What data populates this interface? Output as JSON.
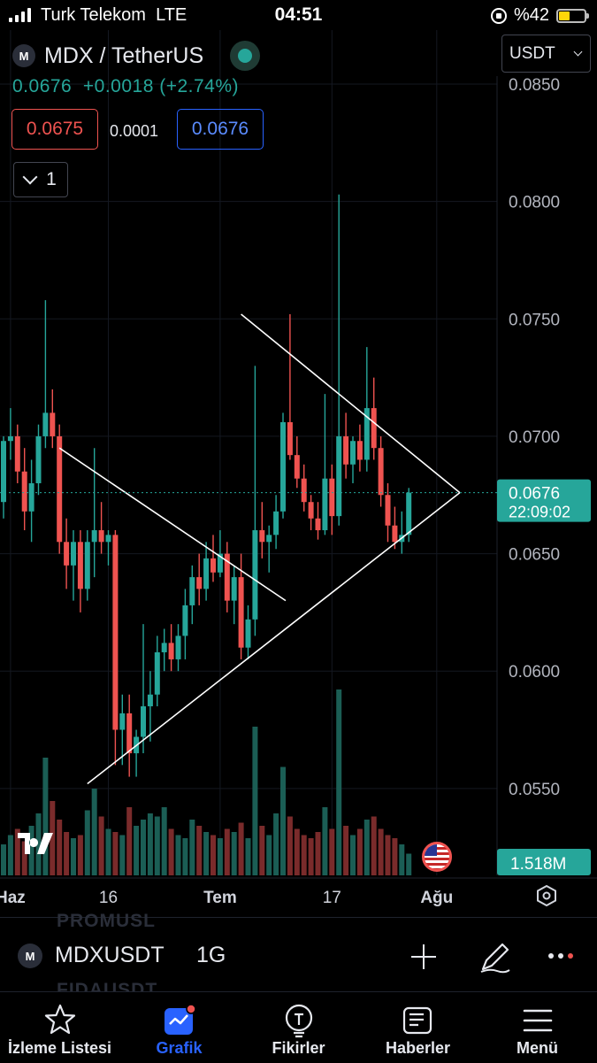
{
  "status_bar": {
    "carrier": "Turk Telekom",
    "network": "LTE",
    "time": "04:51",
    "battery": "%42"
  },
  "header": {
    "title": "MDX / TetherUS",
    "price": "0.0676",
    "change": "+0.0018 (+2.74%)",
    "bid": "0.0675",
    "spread": "0.0001",
    "ask": "0.0676",
    "indicator_count": "1",
    "currency": "USDT",
    "logo_glyph": "M"
  },
  "colors": {
    "up": "#26a69a",
    "down": "#ef5350",
    "accent": "#2962ff",
    "background": "#000000"
  },
  "chart_data": {
    "type": "candlestick",
    "interval": "1G",
    "y_ticks": [
      "0.0850",
      "0.0800",
      "0.0750",
      "0.0700",
      "0.0650",
      "0.0600",
      "0.0550"
    ],
    "y_range": [
      0.0513,
      0.0873
    ],
    "x_ticks": [
      {
        "label": "Haz",
        "index": 1
      },
      {
        "label": "16",
        "index": 15
      },
      {
        "label": "Tem",
        "index": 31
      },
      {
        "label": "17",
        "index": 47
      },
      {
        "label": "Ağu",
        "index": 62
      }
    ],
    "last_price": {
      "value": 0.0676,
      "label": "0.0676",
      "countdown": "22:09:02"
    },
    "volume_label": "1.518M",
    "candles": [
      [
        0.0672,
        0.07,
        0.0665,
        0.0698
      ],
      [
        0.0698,
        0.0712,
        0.069,
        0.07
      ],
      [
        0.07,
        0.0705,
        0.068,
        0.0685
      ],
      [
        0.0685,
        0.0695,
        0.066,
        0.0668
      ],
      [
        0.0668,
        0.069,
        0.0655,
        0.068
      ],
      [
        0.068,
        0.0705,
        0.0675,
        0.07
      ],
      [
        0.07,
        0.0758,
        0.0695,
        0.071
      ],
      [
        0.071,
        0.072,
        0.0695,
        0.07
      ],
      [
        0.07,
        0.0705,
        0.065,
        0.0655
      ],
      [
        0.0655,
        0.0665,
        0.0635,
        0.0645
      ],
      [
        0.0645,
        0.066,
        0.063,
        0.0655
      ],
      [
        0.0655,
        0.066,
        0.0625,
        0.0635
      ],
      [
        0.0635,
        0.066,
        0.063,
        0.0655
      ],
      [
        0.0655,
        0.0695,
        0.064,
        0.066
      ],
      [
        0.066,
        0.0672,
        0.065,
        0.0655
      ],
      [
        0.0655,
        0.066,
        0.0645,
        0.0658
      ],
      [
        0.0658,
        0.066,
        0.056,
        0.0575
      ],
      [
        0.0575,
        0.059,
        0.056,
        0.0582
      ],
      [
        0.0582,
        0.059,
        0.0555,
        0.0565
      ],
      [
        0.0565,
        0.0575,
        0.0555,
        0.0572
      ],
      [
        0.0572,
        0.062,
        0.0565,
        0.0585
      ],
      [
        0.0585,
        0.06,
        0.057,
        0.059
      ],
      [
        0.059,
        0.0615,
        0.0585,
        0.0608
      ],
      [
        0.0608,
        0.0618,
        0.06,
        0.0612
      ],
      [
        0.0612,
        0.062,
        0.06,
        0.0605
      ],
      [
        0.0605,
        0.062,
        0.06,
        0.0615
      ],
      [
        0.0615,
        0.0635,
        0.0605,
        0.0628
      ],
      [
        0.0628,
        0.0645,
        0.062,
        0.064
      ],
      [
        0.064,
        0.065,
        0.0628,
        0.0635
      ],
      [
        0.0635,
        0.0655,
        0.063,
        0.0648
      ],
      [
        0.0648,
        0.0658,
        0.0638,
        0.0642
      ],
      [
        0.0642,
        0.066,
        0.064,
        0.065
      ],
      [
        0.065,
        0.0655,
        0.0625,
        0.063
      ],
      [
        0.063,
        0.0645,
        0.062,
        0.064
      ],
      [
        0.064,
        0.065,
        0.0605,
        0.061
      ],
      [
        0.061,
        0.0628,
        0.0605,
        0.0622
      ],
      [
        0.0622,
        0.073,
        0.0615,
        0.066
      ],
      [
        0.066,
        0.0672,
        0.0648,
        0.0655
      ],
      [
        0.0655,
        0.0662,
        0.0642,
        0.0658
      ],
      [
        0.0658,
        0.0675,
        0.0652,
        0.0668
      ],
      [
        0.0668,
        0.071,
        0.0665,
        0.0706
      ],
      [
        0.0706,
        0.0752,
        0.069,
        0.0692
      ],
      [
        0.0692,
        0.07,
        0.0678,
        0.0682
      ],
      [
        0.0682,
        0.0688,
        0.0668,
        0.0672
      ],
      [
        0.0672,
        0.0675,
        0.066,
        0.0665
      ],
      [
        0.0665,
        0.0672,
        0.0656,
        0.066
      ],
      [
        0.066,
        0.0718,
        0.0658,
        0.0682
      ],
      [
        0.0682,
        0.0688,
        0.0658,
        0.0666
      ],
      [
        0.0666,
        0.0803,
        0.0662,
        0.07
      ],
      [
        0.07,
        0.071,
        0.0682,
        0.0688
      ],
      [
        0.0688,
        0.07,
        0.068,
        0.0698
      ],
      [
        0.0698,
        0.0705,
        0.0685,
        0.069
      ],
      [
        0.069,
        0.0738,
        0.0685,
        0.0712
      ],
      [
        0.0712,
        0.0725,
        0.069,
        0.0695
      ],
      [
        0.0695,
        0.07,
        0.067,
        0.0675
      ],
      [
        0.0675,
        0.068,
        0.0655,
        0.0662
      ],
      [
        0.0662,
        0.067,
        0.0652,
        0.0655
      ],
      [
        0.0655,
        0.0668,
        0.065,
        0.0658
      ],
      [
        0.0658,
        0.0678,
        0.0655,
        0.0676
      ]
    ],
    "volumes": [
      1.0,
      1.3,
      1.5,
      1.1,
      1.6,
      2.0,
      3.8,
      2.4,
      1.8,
      1.4,
      1.2,
      1.3,
      2.1,
      2.8,
      1.9,
      1.5,
      1.4,
      1.3,
      2.2,
      1.6,
      1.8,
      2.0,
      1.9,
      2.2,
      1.5,
      1.3,
      1.2,
      1.8,
      1.6,
      1.4,
      1.3,
      1.2,
      1.5,
      1.4,
      1.7,
      1.2,
      4.8,
      1.6,
      1.3,
      2.0,
      3.5,
      1.9,
      1.5,
      1.3,
      1.2,
      1.4,
      2.2,
      1.5,
      6.0,
      1.6,
      1.3,
      1.5,
      1.8,
      1.9,
      1.5,
      1.3,
      1.2,
      1.0,
      0.7
    ],
    "drawings": [
      {
        "type": "trendline",
        "from": {
          "index": 8,
          "price": 0.0695
        },
        "to": {
          "index": 40,
          "price": 0.063
        }
      },
      {
        "type": "trendline",
        "from": {
          "index": 12,
          "price": 0.0552
        },
        "to": {
          "index": 61,
          "price": 0.0676
        }
      },
      {
        "type": "trendline",
        "from": {
          "index": 34,
          "price": 0.0752
        },
        "to": {
          "index": 61,
          "price": 0.0676
        }
      }
    ]
  },
  "symbol_bar": {
    "ghost_top": "PROMUSL",
    "ghost_bottom": "FIDAUSDT",
    "symbol": "MDXUSDT",
    "interval": "1G"
  },
  "tabs": [
    {
      "label": "İzleme Listesi"
    },
    {
      "label": "Grafik"
    },
    {
      "label": "Fikirler"
    },
    {
      "label": "Haberler"
    },
    {
      "label": "Menü"
    }
  ]
}
